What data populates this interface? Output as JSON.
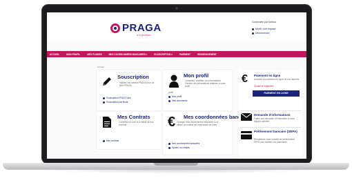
{
  "site": {
    "logo_text": "PRAGA",
    "logo_sub": "NOVEMBER",
    "user_line": "Connectée par bureau",
    "user_links": [
      "Modif. mon espace",
      "Déconnexion"
    ]
  },
  "nav": [
    "Accueil",
    "Mon profil",
    "Mes fluides",
    "Mes coordonnées bancaires ▾",
    "Souscription ▾",
    "Paiement",
    "Renseignement"
  ],
  "breadcrumb": "Accueil",
  "cards": {
    "souscription": {
      "title": "Souscription",
      "desc": "Validez vos contrat PRAGA pour un BIM PRAGA",
      "links": [
        "Souscription PRAGY abo",
        "Souscription par fluide"
      ]
    },
    "profil": {
      "title": "Mon profil",
      "desc": "Consultez, modifiez vos informations. Gestion vos informations relatives à votre profil.",
      "prefix": "profil",
      "links": [
        "Mon profil",
        "Mes documents"
      ]
    },
    "contrats": {
      "title": "Mes Contrats",
      "desc": "Consultez le suivi et le détail de vos contrats",
      "links": [
        "Mes contrats"
      ]
    },
    "bancaires": {
      "title": "Mes coordonnées bancaires",
      "desc": "Changer mes coordonnées bancaires ou à utiliser au contrat les ressources de votre",
      "links": [
        "Mes coordonnées bancaires",
        "Ajouter un compte"
      ]
    }
  },
  "side": {
    "paiement": {
      "title": "Paiement en ligne",
      "desc": "Accédez au paiement en ligne de vos factures",
      "red": "Choisir le règlement",
      "button": "PAIEMENT EN LIGNE"
    },
    "demande": {
      "title": "Demande d'informations",
      "desc": "Faites une demande d'information à notre équipe clientèle"
    },
    "prelevement": {
      "title": "Prélèvement bancaire (SEPA)",
      "desc": "Remplissez votre mandat de prélèvement SEPA pour faciliter vos paiements"
    }
  },
  "colors": {
    "brand_magenta": "#c2185b",
    "brand_navy": "#1a237e",
    "laptop_frame": "#1c1c1e"
  },
  "icons": [
    "pencil-icon",
    "user-icon",
    "euro-icon",
    "document-icon",
    "envelope-icon",
    "wallet-icon"
  ]
}
